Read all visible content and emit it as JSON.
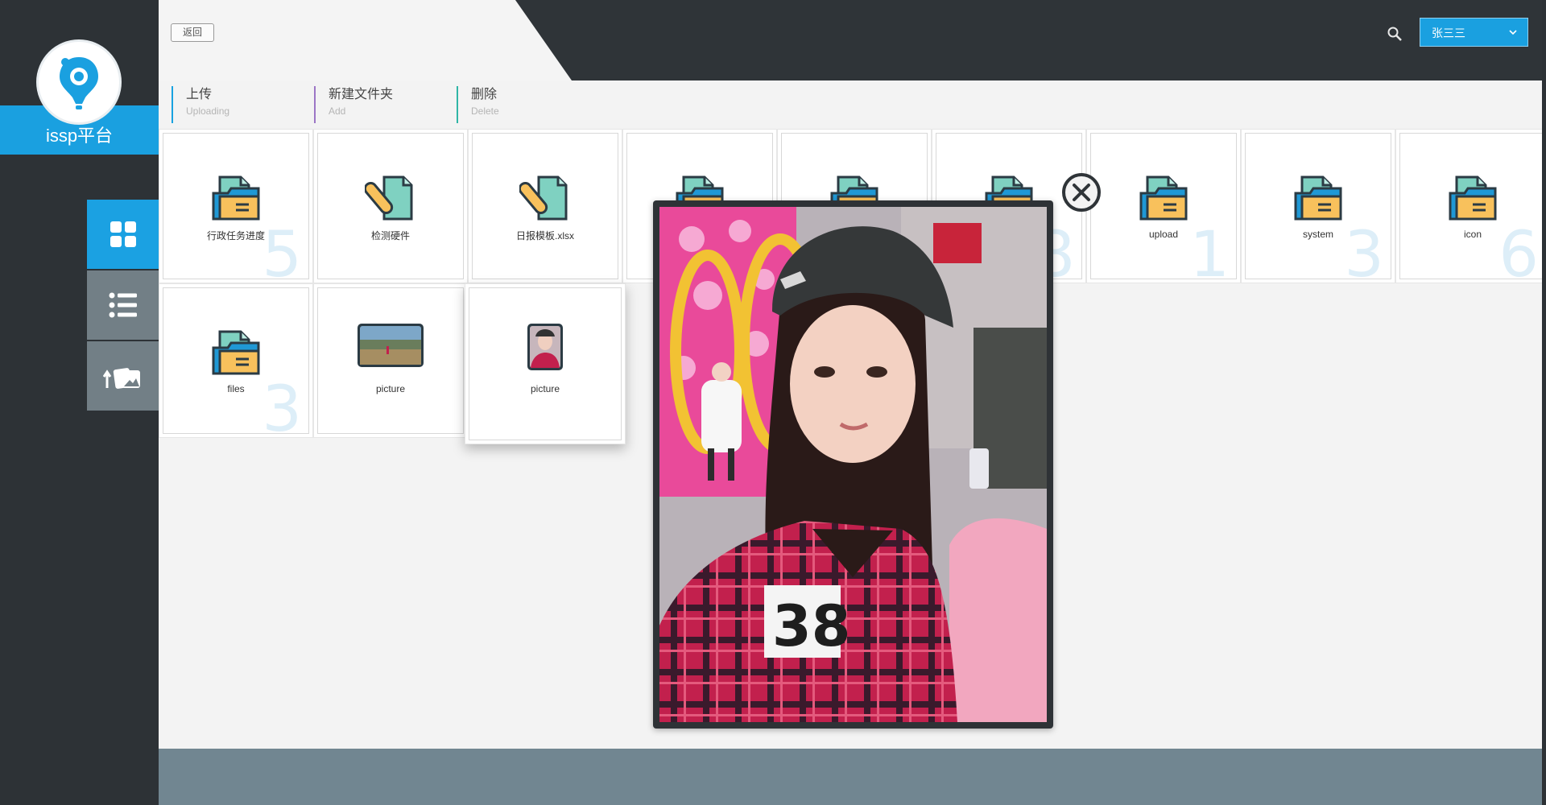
{
  "brand": {
    "name": "issp平台"
  },
  "header": {
    "back_label": "返回",
    "user_name": "张三三"
  },
  "toolbar": [
    {
      "label": "上传",
      "sub": "Uploading"
    },
    {
      "label": "新建文件夹",
      "sub": "Add"
    },
    {
      "label": "删除",
      "sub": "Delete"
    }
  ],
  "nav": [
    {
      "icon": "grid-icon",
      "active": true
    },
    {
      "icon": "list-icon",
      "active": false
    },
    {
      "icon": "upload-images-icon",
      "active": false
    }
  ],
  "files": [
    {
      "name": "行政任务进度",
      "type": "folder",
      "count": "5"
    },
    {
      "name": "检测硬件",
      "type": "attachment",
      "count": ""
    },
    {
      "name": "日报模板.xlsx",
      "type": "attachment",
      "count": ""
    },
    {
      "name": "",
      "type": "folder",
      "count": ""
    },
    {
      "name": "",
      "type": "folder",
      "count": ""
    },
    {
      "name": "",
      "type": "folder",
      "count": "8"
    },
    {
      "name": "upload",
      "type": "folder",
      "count": "1"
    },
    {
      "name": "system",
      "type": "folder",
      "count": "3"
    },
    {
      "name": "icon",
      "type": "folder",
      "count": "6"
    },
    {
      "name": "files",
      "type": "folder",
      "count": "3"
    },
    {
      "name": "picture",
      "type": "image-landscape",
      "count": ""
    },
    {
      "name": "picture",
      "type": "image-portrait",
      "count": "",
      "selected": true
    }
  ],
  "colors": {
    "accent": "#1aa0e0",
    "sidebar": "#2d3236",
    "footer": "#718691"
  }
}
